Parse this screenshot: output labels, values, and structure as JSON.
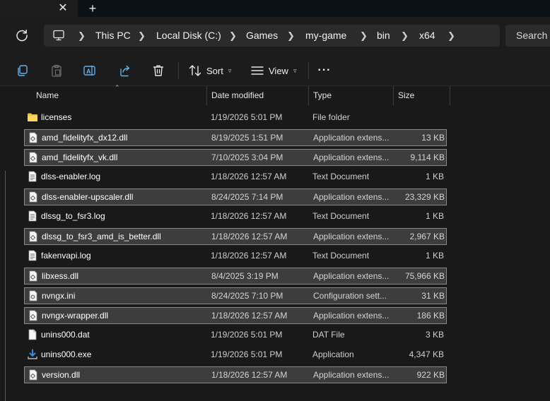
{
  "titlebar": {
    "close_glyph": "✕",
    "new_tab_glyph": "+"
  },
  "address": {
    "breadcrumbs": [
      "This PC",
      "Local Disk (C:)",
      "Games",
      "my-game",
      "bin",
      "x64"
    ],
    "search_placeholder": "Search x"
  },
  "toolbar": {
    "sort_label": "Sort",
    "view_label": "View",
    "more_glyph": "···"
  },
  "columns": {
    "name": "Name",
    "date": "Date modified",
    "type": "Type",
    "size": "Size"
  },
  "files": [
    {
      "name": "licenses",
      "date": "1/19/2026 5:01 PM",
      "type": "File folder",
      "size": "",
      "icon": "folder-icon",
      "selected": false
    },
    {
      "name": "amd_fidelityfx_dx12.dll",
      "date": "8/19/2025 1:51 PM",
      "type": "Application extens...",
      "size": "13 KB",
      "icon": "dll-file-icon",
      "selected": true
    },
    {
      "name": "amd_fidelityfx_vk.dll",
      "date": "7/10/2025 3:04 PM",
      "type": "Application extens...",
      "size": "9,114 KB",
      "icon": "dll-file-icon",
      "selected": true
    },
    {
      "name": "dlss-enabler.log",
      "date": "1/18/2026 12:57 AM",
      "type": "Text Document",
      "size": "1 KB",
      "icon": "text-file-icon",
      "selected": false
    },
    {
      "name": "dlss-enabler-upscaler.dll",
      "date": "8/24/2025 7:14 PM",
      "type": "Application extens...",
      "size": "23,329 KB",
      "icon": "dll-file-icon",
      "selected": true
    },
    {
      "name": "dlssg_to_fsr3.log",
      "date": "1/18/2026 12:57 AM",
      "type": "Text Document",
      "size": "1 KB",
      "icon": "text-file-icon",
      "selected": false
    },
    {
      "name": "dlssg_to_fsr3_amd_is_better.dll",
      "date": "1/18/2026 12:57 AM",
      "type": "Application extens...",
      "size": "2,967 KB",
      "icon": "dll-file-icon",
      "selected": true
    },
    {
      "name": "fakenvapi.log",
      "date": "1/18/2026 12:57 AM",
      "type": "Text Document",
      "size": "1 KB",
      "icon": "text-file-icon",
      "selected": false
    },
    {
      "name": "libxess.dll",
      "date": "8/4/2025 3:19 PM",
      "type": "Application extens...",
      "size": "75,966 KB",
      "icon": "dll-file-icon",
      "selected": true
    },
    {
      "name": "nvngx.ini",
      "date": "8/24/2025 7:10 PM",
      "type": "Configuration sett...",
      "size": "31 KB",
      "icon": "config-file-icon",
      "selected": true
    },
    {
      "name": "nvngx-wrapper.dll",
      "date": "1/18/2026 12:57 AM",
      "type": "Application extens...",
      "size": "186 KB",
      "icon": "dll-file-icon",
      "selected": true
    },
    {
      "name": "unins000.dat",
      "date": "1/19/2026 5:01 PM",
      "type": "DAT File",
      "size": "3 KB",
      "icon": "blank-file-icon",
      "selected": false
    },
    {
      "name": "unins000.exe",
      "date": "1/19/2026 5:01 PM",
      "type": "Application",
      "size": "4,347 KB",
      "icon": "installer-icon",
      "selected": false
    },
    {
      "name": "version.dll",
      "date": "1/18/2026 12:57 AM",
      "type": "Application extens...",
      "size": "922 KB",
      "icon": "dll-file-icon",
      "selected": true
    }
  ]
}
